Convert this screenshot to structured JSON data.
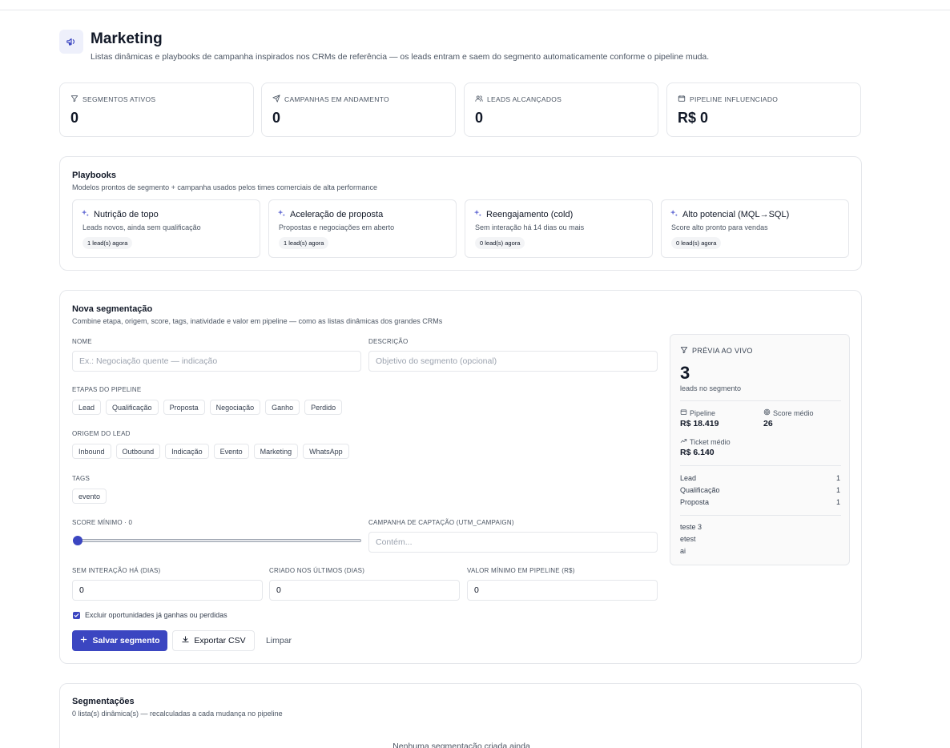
{
  "header": {
    "title": "Marketing",
    "subtitle": "Listas dinâmicas e playbooks de campanha inspirados nos CRMs de referência — os leads entram e saem do segmento automaticamente conforme o pipeline muda.",
    "icon": "megaphone-icon"
  },
  "stats": [
    {
      "label": "SEGMENTOS ATIVOS",
      "value": "0",
      "icon": "filter-icon"
    },
    {
      "label": "CAMPANHAS EM ANDAMENTO",
      "value": "0",
      "icon": "send-icon"
    },
    {
      "label": "LEADS ALCANÇADOS",
      "value": "0",
      "icon": "users-icon"
    },
    {
      "label": "PIPELINE INFLUENCIADO",
      "value": "R$ 0",
      "icon": "wallet-icon"
    }
  ],
  "playbooks": {
    "title": "Playbooks",
    "subtitle": "Modelos prontos de segmento + campanha usados pelos times comerciais de alta performance",
    "items": [
      {
        "title": "Nutrição de topo",
        "desc": "Leads novos, ainda sem qualificação",
        "badge": "1 lead(s) agora"
      },
      {
        "title": "Aceleração de proposta",
        "desc": "Propostas e negociações em aberto",
        "badge": "1 lead(s) agora"
      },
      {
        "title": "Reengajamento (cold)",
        "desc": "Sem interação há 14 dias ou mais",
        "badge": "0 lead(s) agora"
      },
      {
        "title": "Alto potencial (MQL→SQL)",
        "desc": "Score alto pronto para vendas",
        "badge": "0 lead(s) agora"
      }
    ]
  },
  "form": {
    "title": "Nova segmentação",
    "subtitle": "Combine etapa, origem, score, tags, inatividade e valor em pipeline — como as listas dinâmicas dos grandes CRMs",
    "name_label": "NOME",
    "name_placeholder": "Ex.: Negociação quente — indicação",
    "desc_label": "DESCRIÇÃO",
    "desc_placeholder": "Objetivo do segmento (opcional)",
    "stages_label": "ETAPAS DO PIPELINE",
    "stages": [
      "Lead",
      "Qualificação",
      "Proposta",
      "Negociação",
      "Ganho",
      "Perdido"
    ],
    "origin_label": "ORIGEM DO LEAD",
    "origins": [
      "Inbound",
      "Outbound",
      "Indicação",
      "Evento",
      "Marketing",
      "WhatsApp"
    ],
    "tags_label": "TAGS",
    "tags": [
      "evento"
    ],
    "score_label": "SCORE MÍNIMO · 0",
    "score_value": 0,
    "campaign_label": "CAMPANHA DE CAPTAÇÃO (UTM_CAMPAIGN)",
    "campaign_placeholder": "Contém...",
    "inactive_label": "SEM INTERAÇÃO HÁ (DIAS)",
    "inactive_value": "0",
    "created_label": "CRIADO NOS ÚLTIMOS (DIAS)",
    "created_value": "0",
    "min_value_label": "VALOR MÍNIMO EM PIPELINE (R$)",
    "min_value_value": "0",
    "exclude_label": "Excluir oportunidades já ganhas ou perdidas",
    "exclude_checked": true,
    "save_label": "Salvar segmento",
    "export_label": "Exportar CSV",
    "clear_label": "Limpar"
  },
  "preview": {
    "title": "PRÉVIA AO VIVO",
    "count": "3",
    "count_label": "leads no segmento",
    "pipeline_label": "Pipeline",
    "pipeline_value": "R$ 18.419",
    "score_label": "Score médio",
    "score_value": "26",
    "ticket_label": "Ticket médio",
    "ticket_value": "R$ 6.140",
    "stages": [
      {
        "name": "Lead",
        "count": "1"
      },
      {
        "name": "Qualificação",
        "count": "1"
      },
      {
        "name": "Proposta",
        "count": "1"
      }
    ],
    "leads": [
      "teste 3",
      "etest",
      "ai"
    ]
  },
  "segments": {
    "title": "Segmentações",
    "subtitle": "0 lista(s) dinâmica(s) — recalculadas a cada mudança no pipeline",
    "empty": "Nenhuma segmentação criada ainda"
  },
  "colors": {
    "accent": "#3b46c1",
    "border": "#e5e7eb",
    "text": "#111827",
    "muted": "#4b5563"
  }
}
